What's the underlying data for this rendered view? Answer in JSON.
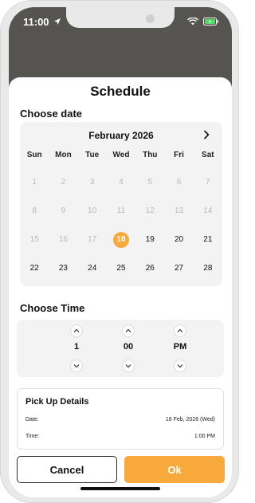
{
  "status": {
    "time": "11:00",
    "icons": [
      "location-arrow-icon",
      "wifi-icon",
      "battery-charging-icon"
    ]
  },
  "sheet": {
    "title": "Schedule"
  },
  "date_section": {
    "label": "Choose date"
  },
  "calendar": {
    "month_label": "February 2026",
    "next_icon": "chevron-right-icon",
    "weekdays": [
      "Sun",
      "Mon",
      "Tue",
      "Wed",
      "Thu",
      "Fri",
      "Sat"
    ],
    "weeks": [
      [
        "1",
        "2",
        "3",
        "4",
        "5",
        "6",
        "7"
      ],
      [
        "8",
        "9",
        "10",
        "11",
        "12",
        "13",
        "14"
      ],
      [
        "15",
        "16",
        "17",
        "18",
        "19",
        "20",
        "21"
      ],
      [
        "22",
        "23",
        "24",
        "25",
        "26",
        "27",
        "28"
      ]
    ],
    "selected_day": "18",
    "colors": {
      "selected": "#f7a93b",
      "disabled": "#b9b9b9"
    }
  },
  "time_section": {
    "label": "Choose Time",
    "hour": "1",
    "minute": "00",
    "period": "PM",
    "up_icon": "chevron-up-icon",
    "down_icon": "chevron-down-icon"
  },
  "details": {
    "title": "Pick Up Details",
    "date_label": "Date:",
    "date_value": "18 Feb, 2026 (Wed)",
    "time_label": "Time:",
    "time_value": "1:00 PM"
  },
  "actions": {
    "cancel_label": "Cancel",
    "ok_label": "Ok"
  },
  "theme": {
    "accent": "#f7a93b",
    "backdrop": "#555451"
  }
}
